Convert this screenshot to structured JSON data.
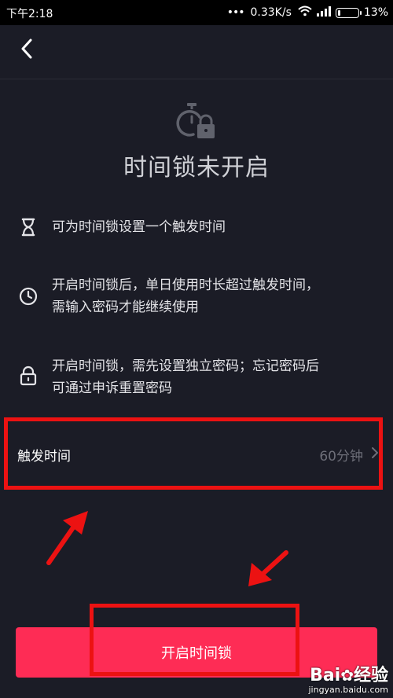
{
  "status_bar": {
    "time": "下午2:18",
    "dots": "•••",
    "network_speed": "0.33K/s",
    "battery": "13%",
    "battery_level": 0.13
  },
  "header": {
    "back_icon": "chevron-left-icon"
  },
  "hero": {
    "icon": "stopwatch-lock-icon",
    "title": "时间锁未开启"
  },
  "info_items": [
    {
      "icon": "hourglass-icon",
      "text_lines": [
        "可为时间锁设置一个触发时间"
      ]
    },
    {
      "icon": "clock-icon",
      "text_lines": [
        "开启时间锁后，单日使用时长超过触发时间，",
        "需输入密码才能继续使用"
      ]
    },
    {
      "icon": "lock-icon",
      "text_lines": [
        "开启时间锁，需先设置独立密码；忘记密码后",
        "可通过申诉重置密码"
      ]
    }
  ],
  "trigger": {
    "label": "触发时间",
    "value": "60分钟",
    "chevron": "chevron-right-icon"
  },
  "cta": {
    "label": "开启时间锁"
  },
  "annotation_color": "#ec1212",
  "accent_color": "#fe2c55",
  "watermark": {
    "logo": "Bai",
    "logo_suffix": "经验",
    "url": "jingyan.baidu.com"
  }
}
